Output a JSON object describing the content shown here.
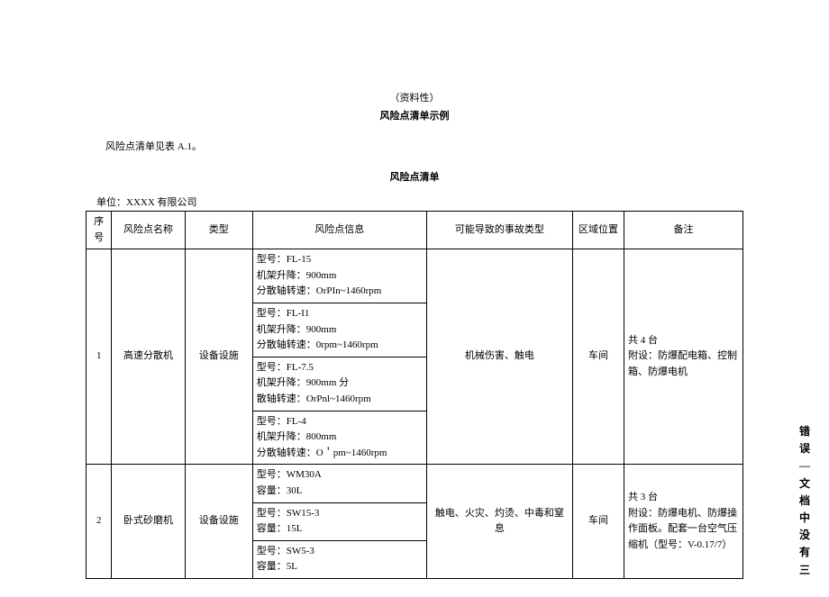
{
  "header": {
    "line1": "（资料性）",
    "line2": "风险点清单示例"
  },
  "intro": "风险点清单见表 A.1。",
  "table_title": "风险点清单",
  "unit_line": "单位：XXXX 有限公司",
  "columns": {
    "idx": "序号",
    "name": "风险点名称",
    "type": "类型",
    "info": "风险点信息",
    "acc": "可能导致的事故类型",
    "loc": "区域位置",
    "note": "备注"
  },
  "rows": [
    {
      "idx": "1",
      "name": "高速分散机",
      "type": "设备设施",
      "info_items": [
        "型号：FL-15\n机架升降：900mm\n分散轴转速：OrPIn~1460rpm",
        "型号：FL-I1\n机架升降：900mm\n分散轴转速：0rpm~1460rpm",
        "型号：FL-7.5\n机架升降：900mm 分\n散轴转速：OrPnl~1460rpm",
        "型号：FL-4\n机架升降：800mm\n分散轴转速：O＇pm~1460rpm"
      ],
      "acc": "机械伤害、触电",
      "loc": "车间",
      "note": "共 4 台\n附设：防爆配电箱、控制箱、防爆电机"
    },
    {
      "idx": "2",
      "name": "卧式砂磨机",
      "type": "设备设施",
      "info_items": [
        "型号：WM30A\n容量：30L",
        "型号：SW15-3\n容量：15L",
        "型号：SW5-3\n容量：5L"
      ],
      "acc": "触电、火灾、灼烫、中毒和窒息",
      "loc": "车间",
      "note": "共 3 台\n附设：防爆电机、防爆操作面板。配套一台空气压缩机（型号：V-0.17/7）"
    }
  ],
  "sidebar": "错误—文档中没有三"
}
